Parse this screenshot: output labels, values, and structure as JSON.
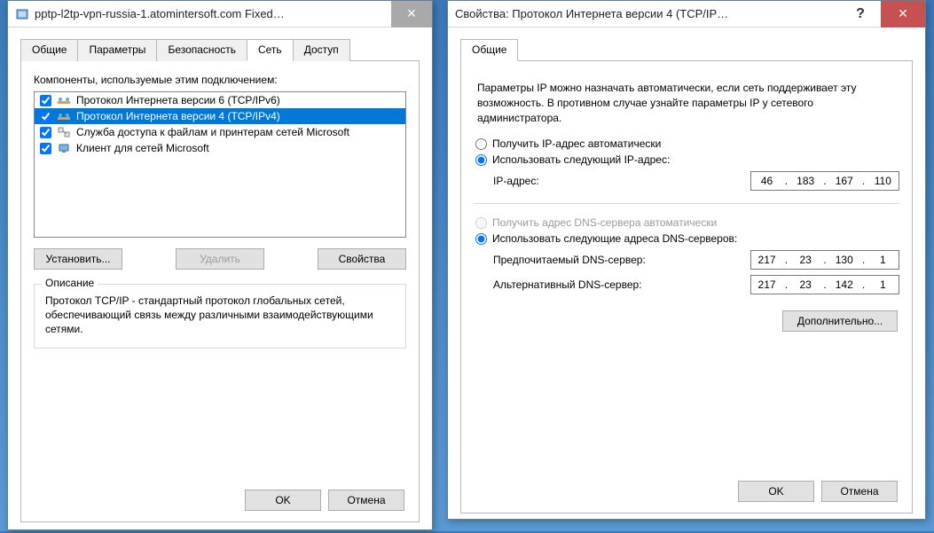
{
  "window1": {
    "title": "pptp-l2tp-vpn-russia-1.atomintersoft.com Fixed…",
    "tabs": [
      "Общие",
      "Параметры",
      "Безопасность",
      "Сеть",
      "Доступ"
    ],
    "active_tab": 3,
    "components_label": "Компоненты, используемые этим подключением:",
    "items": [
      {
        "checked": true,
        "label": "Протокол Интернета версии 6 (TCP/IPv6)"
      },
      {
        "checked": true,
        "label": "Протокол Интернета версии 4 (TCP/IPv4)"
      },
      {
        "checked": true,
        "label": "Служба доступа к файлам и принтерам сетей Microsoft"
      },
      {
        "checked": true,
        "label": "Клиент для сетей Microsoft"
      }
    ],
    "btn_install": "Установить...",
    "btn_remove": "Удалить",
    "btn_props": "Свойства",
    "desc_title": "Описание",
    "desc_text": "Протокол TCP/IP - стандартный протокол глобальных сетей, обеспечивающий связь между различными взаимодействующими сетями.",
    "btn_ok": "OK",
    "btn_cancel": "Отмена"
  },
  "window2": {
    "title": "Свойства: Протокол Интернета версии 4 (TCP/IP…",
    "tab": "Общие",
    "info": "Параметры IP можно назначать автоматически, если сеть поддерживает эту возможность. В противном случае узнайте параметры IP у сетевого администратора.",
    "ip_auto": "Получить IP-адрес автоматически",
    "ip_manual": "Использовать следующий IP-адрес:",
    "ip_label": "IP-адрес:",
    "ip_value": [
      "46",
      "183",
      "167",
      "110"
    ],
    "dns_auto": "Получить адрес DNS-сервера автоматически",
    "dns_manual": "Использовать следующие адреса DNS-серверов:",
    "dns1_label": "Предпочитаемый DNS-сервер:",
    "dns1_value": [
      "217",
      "23",
      "130",
      "1"
    ],
    "dns2_label": "Альтернативный DNS-сервер:",
    "dns2_value": [
      "217",
      "23",
      "142",
      "1"
    ],
    "btn_advanced": "Дополнительно...",
    "btn_ok": "OK",
    "btn_cancel": "Отмена"
  }
}
